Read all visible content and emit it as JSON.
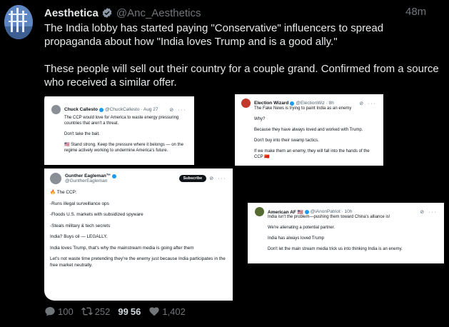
{
  "tweet": {
    "author_name": "Aesthetica",
    "author_handle": "@Anc_Aesthetics",
    "time": "48m",
    "paragraphs": [
      "The India lobby has started paying \"Conservative\" influencers to spread propaganda about how \"India loves Trump and is a good ally.\"",
      "These people will sell out their country for a couple grand. Confirmed from a source who received a similar offer."
    ]
  },
  "embedded_posts": [
    {
      "name": "Chuck Callesto",
      "handle": "@ChuckCallesto · Aug 27",
      "lines": [
        "The CCP would love for America to waste energy pressuring countries that aren't a threat.",
        "Don't take the bait.",
        "🇺🇸 Stand strong. Keep the pressure where it belongs — on the regime actively working to undermine America's future."
      ]
    },
    {
      "name": "Election Wizard",
      "handle": "@ElectionWiz · 8h",
      "lines": [
        "The Fake News is trying to paint India as an enemy",
        "Why?",
        "Because they have always loved and worked with Trump.",
        "Don't buy into their swamp tactics.",
        "If we make them an enemy, they will fall into the hands of the CCP 🇨🇳"
      ]
    },
    {
      "name": "Gunther Eagleman™",
      "handle": "@GuntherEagleman",
      "subscribe_label": "Subscribe",
      "lines": [
        "🔥 The CCP:",
        "-Runs illegal surveillance ops",
        "-Floods U.S. markets with subsidized spyware",
        "-Steals military & tech secrets",
        "India? Buys oil — LEGALLY.",
        "India loves Trump, that's why the mainstream media is going after them",
        "Let's not waste time pretending they're the enemy just because India participates in the free market neutrally."
      ]
    },
    {
      "name": "American AF 🇺🇸",
      "handle": "@iAnonPatriot · 10h",
      "lines": [
        "India isn't the problem—pushing them toward China's alliance is!",
        "We're alienating a potential partner.",
        "India has always loved Trump",
        "Don't let the main stream media trick us into thinking India is an enemy."
      ]
    }
  ],
  "actions": {
    "replies": "100",
    "reposts": "252",
    "quotes": "56",
    "views": "1,402"
  },
  "colors": {
    "background": "#000000",
    "text": "#e7e9ea",
    "muted": "#71767b",
    "verified": "#1d9bf0"
  }
}
